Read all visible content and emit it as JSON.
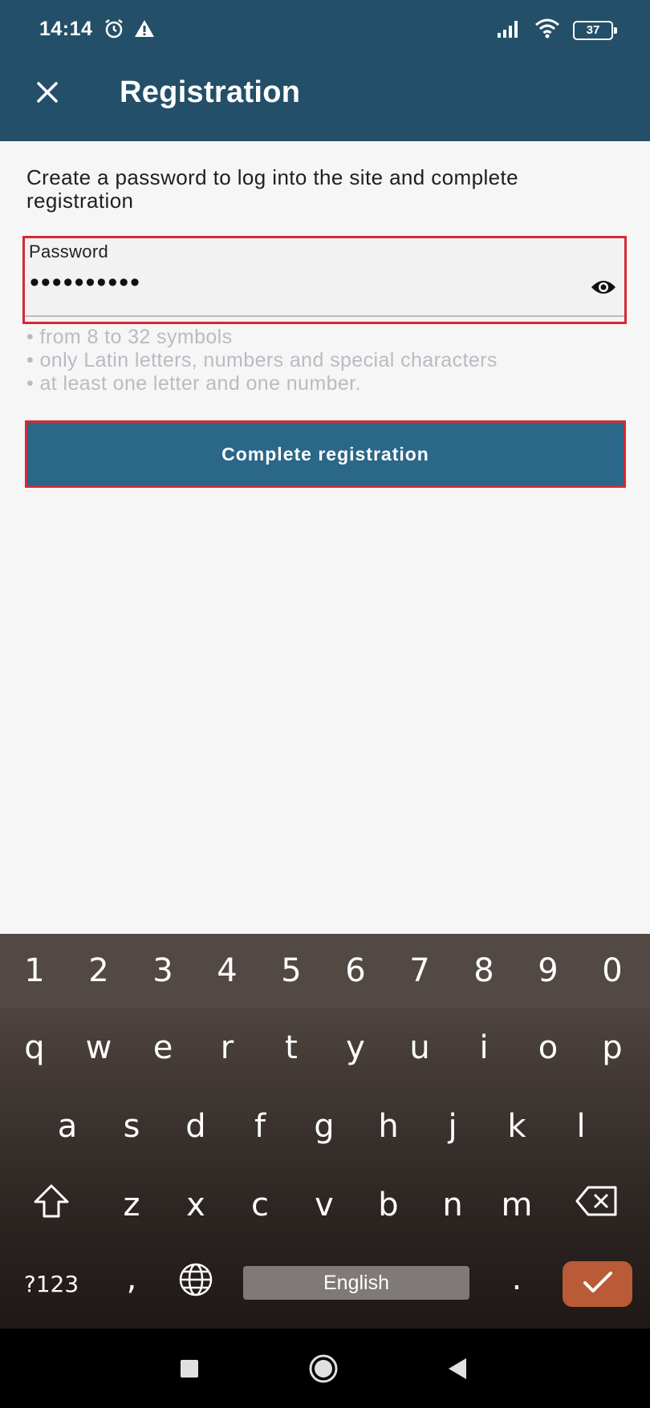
{
  "status_bar": {
    "time": "14:14",
    "battery": "37"
  },
  "app_bar": {
    "title": "Registration"
  },
  "intro_text": "Create a password to log into the site and complete registration",
  "password_field": {
    "label": "Password",
    "value": "••••••••••"
  },
  "rules": [
    "from 8 to 32 symbols",
    "only Latin letters, numbers and special characters",
    "at least one letter and one number."
  ],
  "complete_button": "Complete registration",
  "keyboard": {
    "numbers": [
      "1",
      "2",
      "3",
      "4",
      "5",
      "6",
      "7",
      "8",
      "9",
      "0"
    ],
    "row1": [
      "q",
      "w",
      "e",
      "r",
      "t",
      "y",
      "u",
      "i",
      "o",
      "p"
    ],
    "row2": [
      "a",
      "s",
      "d",
      "f",
      "g",
      "h",
      "j",
      "k",
      "l"
    ],
    "row3": [
      "z",
      "x",
      "c",
      "v",
      "b",
      "n",
      "m"
    ],
    "symbols_key": "?123",
    "comma_key": ",",
    "space_label": "English",
    "period_key": "."
  },
  "colors": {
    "header": "#244f68",
    "button": "#2a6789",
    "highlight": "#d32a35",
    "enter": "#b95b36"
  }
}
